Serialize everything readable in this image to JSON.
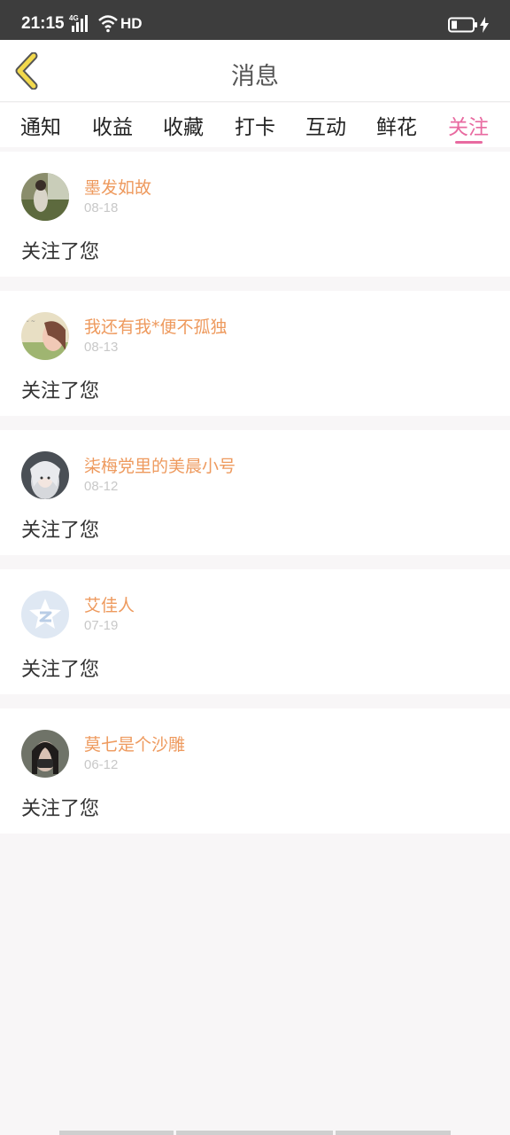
{
  "status_bar": {
    "time": "21:15",
    "network": "4G",
    "hd": "HD",
    "icons": [
      "signal-icon",
      "wifi-icon",
      "battery-icon",
      "charging-icon"
    ]
  },
  "header": {
    "title": "消息",
    "back_icon": "chevron-left-icon",
    "back_color": "#f2d94c"
  },
  "tabs": [
    {
      "label": "通知"
    },
    {
      "label": "收益"
    },
    {
      "label": "收藏"
    },
    {
      "label": "打卡"
    },
    {
      "label": "互动"
    },
    {
      "label": "鲜花"
    },
    {
      "label": "关注",
      "active": true
    }
  ],
  "notifications": [
    {
      "username": "墨发如故",
      "date": "08-18",
      "message": "关注了您"
    },
    {
      "username": "我还有我*便不孤独",
      "date": "08-13",
      "message": "关注了您"
    },
    {
      "username": "柒梅党里的美晨小号",
      "date": "08-12",
      "message": "关注了您"
    },
    {
      "username": "艾佳人",
      "date": "07-19",
      "message": "关注了您"
    },
    {
      "username": "莫七是个沙雕",
      "date": "06-12",
      "message": "关注了您"
    }
  ],
  "colors": {
    "accent": "#e86aa0",
    "username": "#ee9a5e",
    "date": "#c8c8c8",
    "background": "#f8f6f7"
  }
}
